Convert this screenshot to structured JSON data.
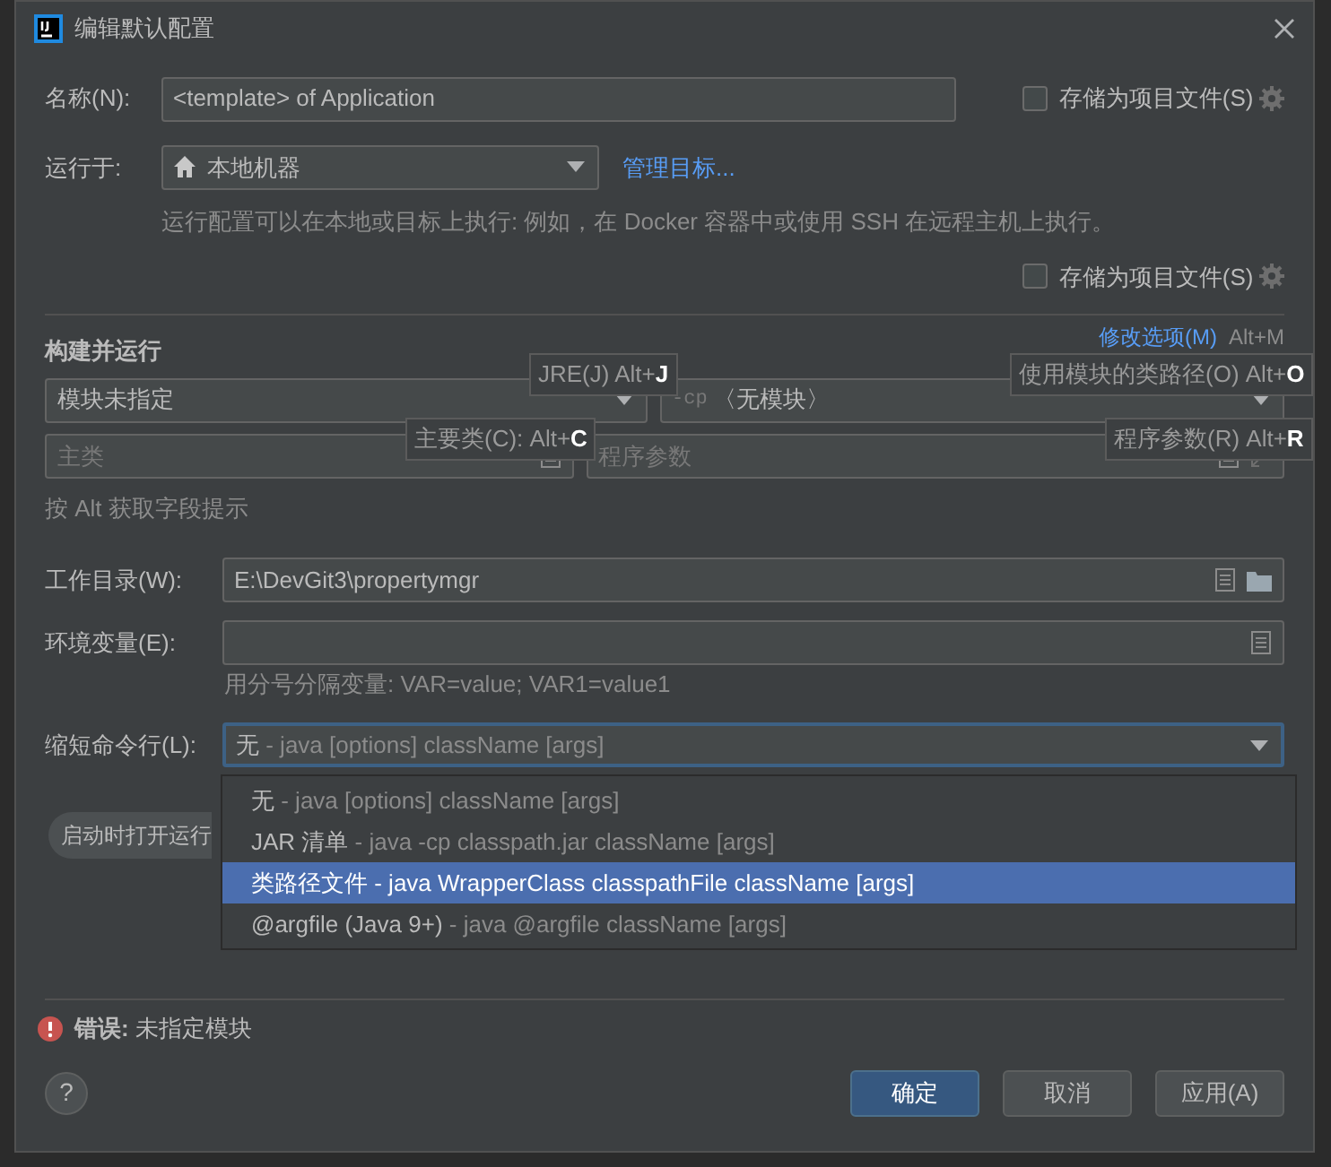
{
  "window": {
    "title": "编辑默认配置"
  },
  "name_field": {
    "label": "名称(N):",
    "value": "<template> of Application"
  },
  "store_options": [
    {
      "label": "存储为项目文件(S)",
      "checked": false
    },
    {
      "label": "存储为项目文件(S)",
      "checked": false
    }
  ],
  "run_on": {
    "label": "运行于:",
    "value": "本地机器",
    "link": "管理目标...",
    "hint": "运行配置可以在本地或目标上执行: 例如，在 Docker 容器中或使用 SSH 在远程主机上执行。"
  },
  "build_run": {
    "title": "构建并运行",
    "modify_link": "修改选项(M)",
    "modify_shortcut": "Alt+M",
    "module": "模块未指定",
    "classpath_prefix": "-cp",
    "classpath": "〈无模块〉",
    "main_class_placeholder": "主类",
    "args_placeholder": "程序参数",
    "hint": "按 Alt 获取字段提示",
    "tooltips": [
      {
        "text": "JRE(J) Alt+**J**"
      },
      {
        "text": "使用模块的类路径(O) Alt+**O**"
      },
      {
        "text": "主要类(C): Alt+**C**"
      },
      {
        "text": "程序参数(R) Alt+**R**"
      }
    ]
  },
  "working_dir": {
    "label": "工作目录(W):",
    "value": "E:\\DevGit3\\propertymgr"
  },
  "env": {
    "label": "环境变量(E):",
    "hint": "用分号分隔变量: VAR=value; VAR1=value1"
  },
  "shorten": {
    "label": "缩短命令行(L):",
    "value_main": "无",
    "value_detail": "- java [options] className [args]",
    "options": [
      {
        "main": "无",
        "detail": "- java [options] className [args]",
        "selected": false
      },
      {
        "main": "JAR 清单",
        "detail": "- java -cp classpath.jar className [args]",
        "selected": false
      },
      {
        "main": "类路径文件",
        "detail": "- java WrapperClass classpathFile className [args]",
        "selected": true
      },
      {
        "main": "@argfile (Java 9+)",
        "detail": "- java @argfile className [args]",
        "selected": false
      }
    ]
  },
  "startup_button": "启动时打开运行",
  "error": "**错误:** 未指定模块",
  "buttons": [
    {
      "label": "确定",
      "kind": "primary"
    },
    {
      "label": "取消",
      "kind": "normal"
    },
    {
      "label": "应用(A)",
      "kind": "normal"
    }
  ],
  "help": "?"
}
